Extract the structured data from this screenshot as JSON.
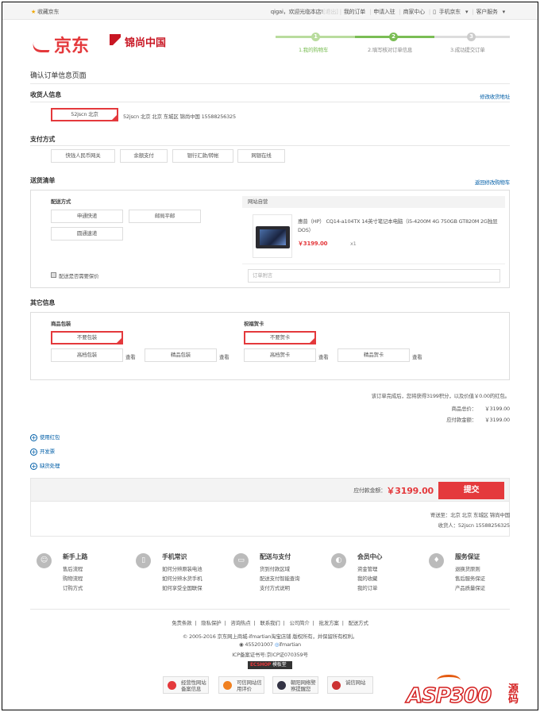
{
  "topbar": {
    "favorite": "收藏京东",
    "user": "qigai，欢迎光临本店!",
    "logout": "[退出]",
    "nav": [
      "我的订单",
      "申请入驻",
      "商家中心",
      "手机京东",
      "客户服务"
    ]
  },
  "logo": {
    "brand": "京东",
    "shop": "锦尚中国"
  },
  "steps": [
    {
      "num": "1",
      "label": "1.我的购物车"
    },
    {
      "num": "2",
      "label": "2.填写核对订单信息"
    },
    {
      "num": "3",
      "label": "3.成功提交订单"
    }
  ],
  "page_title": "确认订单信息页面",
  "receiver": {
    "title": "收货人信息",
    "edit_link": "修改收货地址",
    "selected": "52jscn 北京",
    "detail": "52jscn  北京 北京 东城区 锦尚中国  15588256325"
  },
  "payment": {
    "title": "支付方式",
    "options": [
      "快钱人民币网关",
      "余额支付",
      "银行汇款/转帐",
      "网银在线"
    ]
  },
  "delivery": {
    "title": "送货清单",
    "back_link": "返回修改购物车",
    "method_title": "配送方式",
    "methods": [
      "申通快递",
      "邮局平邮",
      "圆通速递"
    ],
    "insure": "配送是否需要保价",
    "panel_header": "网站自营",
    "product_name": "惠普（HP） CQ14-a104TX 14英寸笔记本电脑（i5-4200M 4G 750GB GT820M 2G独显 DOS）",
    "product_price": "￥3199.00",
    "product_qty": "x1",
    "note_placeholder": "订单附言"
  },
  "other": {
    "title": "其它信息",
    "pack_title": "商品包装",
    "card_title": "祝福贺卡",
    "pack_selected": "不要包装",
    "card_selected": "不要贺卡",
    "packs": [
      "高档包装",
      "精品包装"
    ],
    "cards": [
      "高档贺卡",
      "精品贺卡"
    ],
    "view": "查看"
  },
  "summary": {
    "points_line": "该订单完成后，您将获得3199积分，以及价值￥0.00的红包。",
    "goods_label": "商品总价：",
    "goods_value": "￥3199.00",
    "payable_label": "应付款金额：",
    "payable_value": "￥3199.00"
  },
  "extras": [
    "使用红包",
    "开发票",
    "缺货处理"
  ],
  "paybar": {
    "label": "应付款金额：",
    "amount": "￥3199.00",
    "submit": "提交"
  },
  "shipto": {
    "line1": "寄送至：北京 北京 东城区 锦尚中国",
    "line2": "收货人：52jscn 15588256325"
  },
  "footer_cols": [
    {
      "title": "新手上路",
      "items": [
        "售后流程",
        "购物流程",
        "订购方式"
      ]
    },
    {
      "title": "手机常识",
      "items": [
        "如何分辨原装电池",
        "如何分辨水货手机",
        "如何享受全国联保"
      ]
    },
    {
      "title": "配送与支付",
      "items": [
        "货到付款区域",
        "配送支付智能查询",
        "支付方式说明"
      ]
    },
    {
      "title": "会员中心",
      "items": [
        "资金管理",
        "我的收藏",
        "我的订单"
      ]
    },
    {
      "title": "服务保证",
      "items": [
        "退换货原则",
        "售后服务保证",
        "产品质量保证"
      ]
    }
  ],
  "footer_links": [
    "免责条款",
    "隐私保护",
    "咨询热点",
    "联系我们",
    "公司简介",
    "批发方案",
    "配送方式"
  ],
  "copyright": "© 2005-2016 京东网上商城-ifmartian淘宝店铺 版权所有，并保留所有权利。",
  "qq": "455201007",
  "ww": "ifmartian",
  "icp": "ICP备案证书号:京ICP证070359号",
  "ecshop": {
    "a": "ECSHOP",
    "b": "模板堂"
  },
  "badges": [
    "经营性网站备案信息",
    "可信网站信用评价",
    "朝阳网络警察提醒您",
    "诚信网站"
  ],
  "watermark": {
    "text": "ASP300",
    "cn": "源码"
  },
  "colors": {
    "accent": "#e4393c",
    "link": "#005ea7",
    "step_done": "#7abd54"
  }
}
